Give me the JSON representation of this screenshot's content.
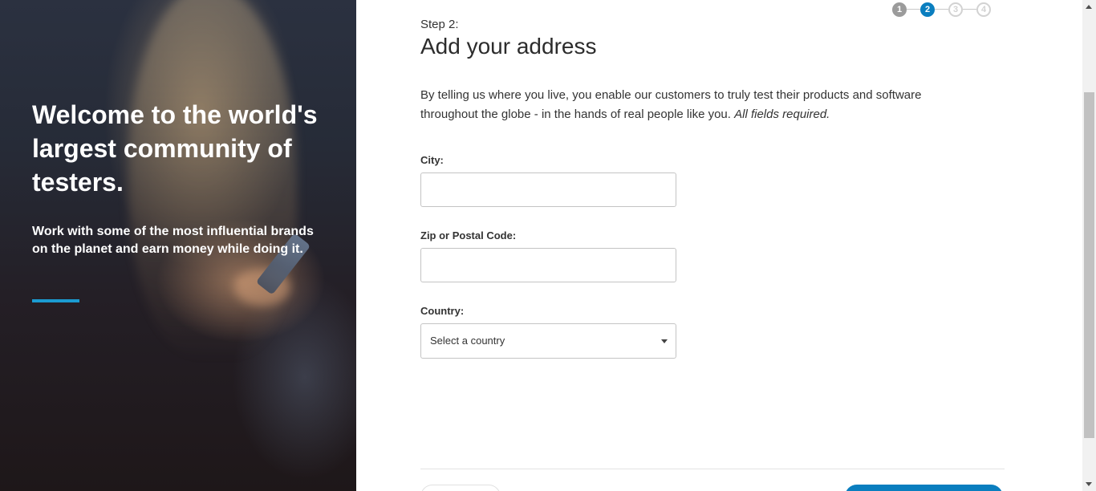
{
  "hero": {
    "title": "Welcome to the world's largest community of testers.",
    "subtitle": "Work with some of the most influential brands on the planet and earn money while doing it.",
    "accent_color": "#1b9bd1"
  },
  "progress": {
    "steps": [
      "1",
      "2",
      "3",
      "4"
    ],
    "current": 2,
    "active_color": "#0a7ebf"
  },
  "form": {
    "step_label": "Step 2:",
    "title": "Add your address",
    "intro": "By telling us where you live, you enable our customers to truly test their products and software throughout the globe - in the hands of real people like you.",
    "intro_note": "All fields required.",
    "city_label": "City:",
    "city_value": "",
    "zip_label": "Zip or Postal Code:",
    "zip_value": "",
    "country_label": "Country:",
    "country_selected": "Select a country"
  }
}
